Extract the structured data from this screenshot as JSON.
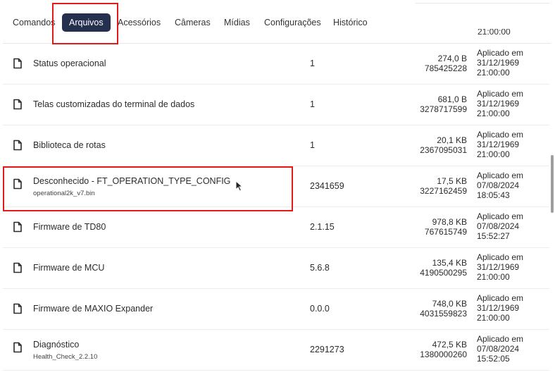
{
  "tabs": [
    {
      "label": "Comandos",
      "active": false
    },
    {
      "label": "Arquivos",
      "active": true
    },
    {
      "label": "Acessórios",
      "active": false
    },
    {
      "label": "Câmeras",
      "active": false
    },
    {
      "label": "Mídias",
      "active": false
    },
    {
      "label": "Configurações",
      "active": false
    },
    {
      "label": "Histórico",
      "active": false
    }
  ],
  "peek_text": "21:00:00",
  "rows": [
    {
      "name": "Status operacional",
      "sub": "",
      "version": "1",
      "size": "274,0 B",
      "id": "785425228",
      "status": [
        "Aplicado em",
        "31/12/1969",
        "21:00:00"
      ],
      "icon": "file-icon"
    },
    {
      "name": "Telas customizadas do terminal de dados",
      "sub": "",
      "version": "1",
      "size": "681,0 B",
      "id": "3278717599",
      "status": [
        "Aplicado em",
        "31/12/1969",
        "21:00:00"
      ],
      "icon": "file-icon"
    },
    {
      "name": "Biblioteca de rotas",
      "sub": "",
      "version": "1",
      "size": "20,1 KB",
      "id": "2367095031",
      "status": [
        "Aplicado em",
        "31/12/1969",
        "21:00:00"
      ],
      "icon": "file-icon"
    },
    {
      "name": "Desconhecido - FT_OPERATION_TYPE_CONFIG",
      "sub": "operational2k_v7.bin",
      "version": "2341659",
      "size": "17,5 KB",
      "id": "3227162459",
      "status": [
        "Aplicado em",
        "07/08/2024",
        "18:05:43"
      ],
      "icon": "file-icon"
    },
    {
      "name": "Firmware de TD80",
      "sub": "",
      "version": "2.1.15",
      "size": "978,8 KB",
      "id": "767615749",
      "status": [
        "Aplicado em",
        "07/08/2024",
        "15:52:27"
      ],
      "icon": "file-icon"
    },
    {
      "name": "Firmware de MCU",
      "sub": "",
      "version": "5.6.8",
      "size": "135,4 KB",
      "id": "4190500295",
      "status": [
        "Aplicado em",
        "31/12/1969",
        "21:00:00"
      ],
      "icon": "file-icon"
    },
    {
      "name": "Firmware de MAXIO Expander",
      "sub": "",
      "version": "0.0.0",
      "size": "748,0 KB",
      "id": "4031559823",
      "status": [
        "Aplicado em",
        "31/12/1969",
        "21:00:00"
      ],
      "icon": "file-icon"
    },
    {
      "name": "Diagnóstico",
      "sub": "Health_Check_2.2.10",
      "version": "2291273",
      "size": "472,5 KB",
      "id": "1380000260",
      "status": [
        "Aplicado em",
        "07/08/2024",
        "15:52:05"
      ],
      "icon": "file-icon"
    }
  ],
  "colors": {
    "active_tab_bg": "#25304f",
    "highlight": "#e11b1b"
  }
}
